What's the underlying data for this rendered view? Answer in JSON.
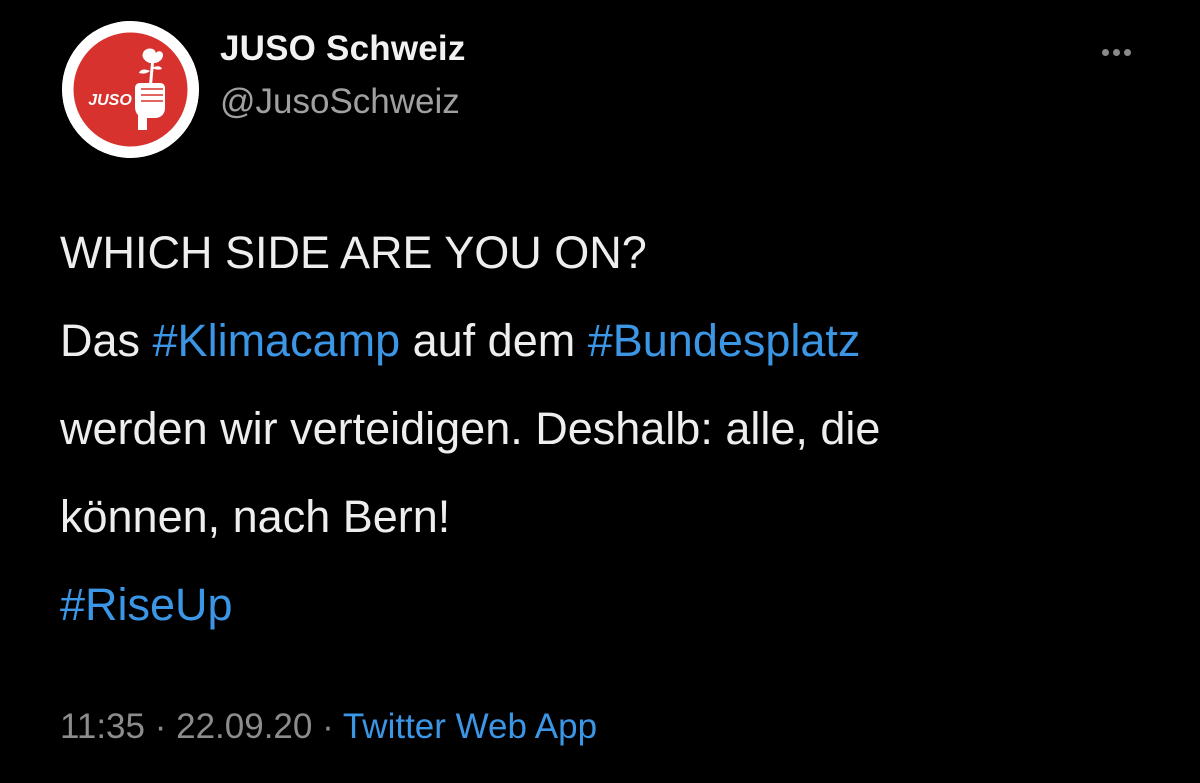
{
  "author": {
    "display_name": "JUSO Schweiz",
    "handle": "@JusoSchweiz",
    "avatar_logo_text": "JUSO"
  },
  "more_icon": "more-horizontal-icon",
  "tweet": {
    "line1": "WHICH SIDE ARE YOU ON?",
    "line2_a": "Das ",
    "hashtag1": "#Klimacamp",
    "line2_b": " auf dem ",
    "hashtag2": "#Bundesplatz",
    "line3": "werden wir verteidigen. Deshalb: alle, die",
    "line4": "können, nach Bern!",
    "hashtag3": "#RiseUp"
  },
  "meta": {
    "time": "11:35",
    "separator1": " · ",
    "date": "22.09.20",
    "separator2": " · ",
    "source": "Twitter Web App"
  },
  "colors": {
    "background": "#000000",
    "link": "#3b96e6",
    "brand_red": "#d7322d"
  }
}
